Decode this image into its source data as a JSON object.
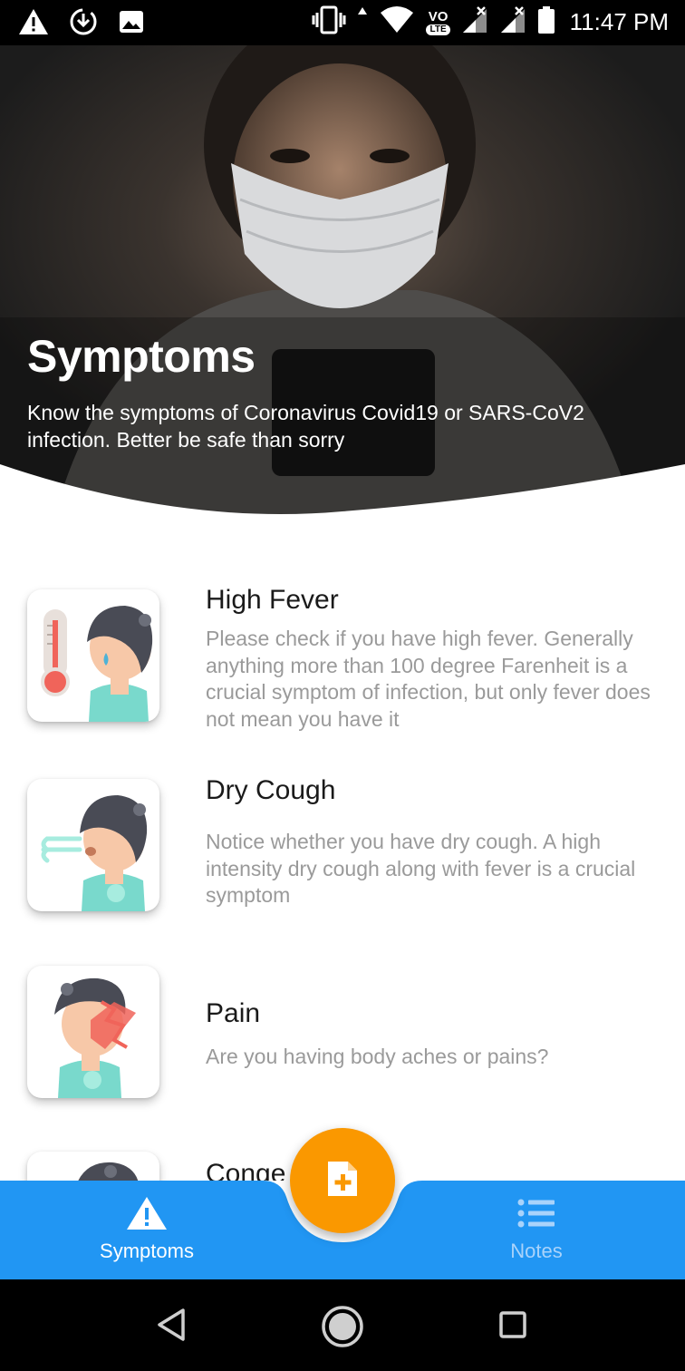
{
  "status_bar": {
    "time": "11:47 PM",
    "volte": "VO",
    "lte": "LTE",
    "icons": [
      "warning-icon",
      "download-icon",
      "image-icon",
      "vibrate-icon",
      "data-arrow-icon",
      "wifi-icon",
      "signal-icon",
      "signal-icon",
      "battery-icon"
    ]
  },
  "hero": {
    "title": "Symptoms",
    "subtitle": "Know the symptoms of Coronavirus Covid19 or SARS-CoV2 infection. Better be safe than sorry"
  },
  "symptoms": [
    {
      "title": "High Fever",
      "description": "Please check if you have high fever. Generally anything more than 100 degree Farenheit is a crucial symptom of infection, but only fever does not mean you have it",
      "icon": "fever-icon"
    },
    {
      "title": "Dry Cough",
      "description": "Notice whether you have dry cough. A high intensity dry cough along with fever is a crucial symptom",
      "icon": "cough-icon"
    },
    {
      "title": "Pain",
      "description": "Are you having body aches or pains?",
      "icon": "pain-icon"
    },
    {
      "title": "Conge",
      "description": "",
      "icon": "congestion-icon"
    }
  ],
  "bottom_nav": {
    "items": [
      {
        "label": "Symptoms",
        "icon": "warning-icon",
        "active": true
      },
      {
        "label": "Notes",
        "icon": "list-icon",
        "active": false
      }
    ],
    "fab_icon": "add-note-icon"
  },
  "system_nav": [
    "back-icon",
    "home-icon",
    "recents-icon"
  ],
  "colors": {
    "accent_blue": "#2196f3",
    "fab_orange": "#fa9800",
    "active_nav_text": "#ffffff",
    "inactive_nav_text": "#a9d3fb",
    "title_text": "#1a1a1a",
    "description_text": "#9a9a9a"
  }
}
